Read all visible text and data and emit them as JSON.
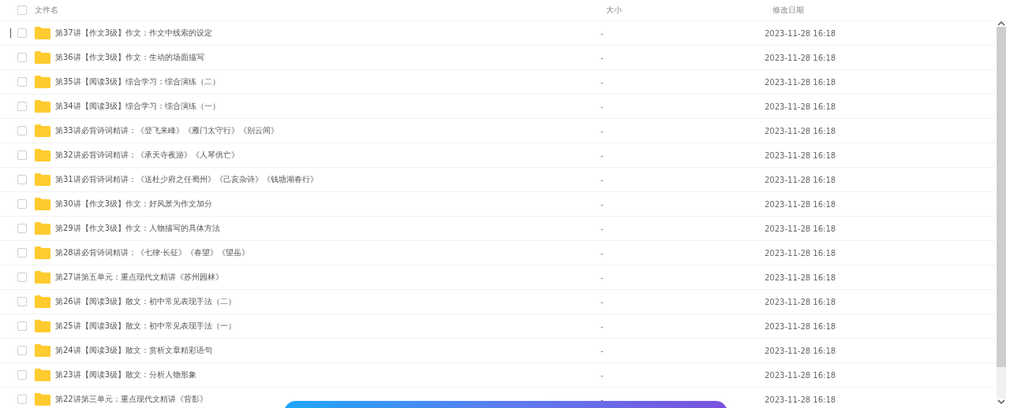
{
  "table": {
    "header": {
      "checked": false,
      "columns": [
        "文件名",
        "大小",
        "修改日期"
      ]
    },
    "rows": [
      {
        "name": "第37讲【作文3级】作文：作文中线索的设定",
        "size": "-",
        "modified": "2023-11-28 16:18",
        "checked": false
      },
      {
        "name": "第36讲【作文3级】作文：生动的场面描写",
        "size": "-",
        "modified": "2023-11-28 16:18",
        "checked": false
      },
      {
        "name": "第35讲【阅读3级】综合学习：综合演练（二）",
        "size": "-",
        "modified": "2023-11-28 16:18",
        "checked": false
      },
      {
        "name": "第34讲【阅读3级】综合学习：综合演练（一）",
        "size": "-",
        "modified": "2023-11-28 16:18",
        "checked": false
      },
      {
        "name": "第33讲必背诗词精讲：《登飞来峰》《雁门太守行》《别云间》",
        "size": "-",
        "modified": "2023-11-28 16:18",
        "checked": false
      },
      {
        "name": "第32讲必背诗词精讲：《承天寺夜游》《人琴俱亡》",
        "size": "-",
        "modified": "2023-11-28 16:18",
        "checked": false
      },
      {
        "name": "第31讲必背诗词精讲：《送杜少府之任蜀州》《己亥杂诗》《钱塘湖春行》",
        "size": "-",
        "modified": "2023-11-28 16:18",
        "checked": false
      },
      {
        "name": "第30讲【作文3级】作文：好风景为作文加分",
        "size": "-",
        "modified": "2023-11-28 16:18",
        "checked": false
      },
      {
        "name": "第29讲【作文3级】作文：人物描写的具体方法",
        "size": "-",
        "modified": "2023-11-28 16:18",
        "checked": false
      },
      {
        "name": "第28讲必背诗词精讲：《七律·长征》《春望》《望岳》",
        "size": "-",
        "modified": "2023-11-28 16:18",
        "checked": false
      },
      {
        "name": "第27讲第五单元：重点现代文精讲《苏州园林》",
        "size": "-",
        "modified": "2023-11-28 16:18",
        "checked": false
      },
      {
        "name": "第26讲【阅读3级】散文：初中常见表现手法（二）",
        "size": "-",
        "modified": "2023-11-28 16:18",
        "checked": false
      },
      {
        "name": "第25讲【阅读3级】散文：初中常见表现手法（一）",
        "size": "-",
        "modified": "2023-11-28 16:18",
        "checked": false
      },
      {
        "name": "第24讲【阅读3级】散文：赏析文章精彩语句",
        "size": "-",
        "modified": "2023-11-28 16:18",
        "checked": false
      },
      {
        "name": "第23讲【阅读3级】散文：分析人物形象",
        "size": "-",
        "modified": "2023-11-28 16:18",
        "checked": false
      },
      {
        "name": "第22讲第三单元：重点现代文精讲《背影》",
        "size": "-",
        "modified": "2023-11-28 16:18",
        "checked": false
      }
    ]
  }
}
